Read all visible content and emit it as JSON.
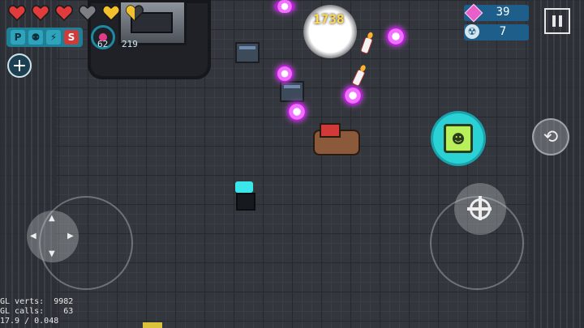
{
  "hud": {
    "hearts": [
      {
        "type": "full",
        "color": "#e23b3b"
      },
      {
        "type": "full",
        "color": "#e23b3b"
      },
      {
        "type": "full",
        "color": "#e23b3b"
      },
      {
        "type": "empty",
        "color": "#7d7f84"
      },
      {
        "type": "armor",
        "color": "#f2c12b"
      },
      {
        "type": "armor-half",
        "color": "#f2c12b"
      }
    ],
    "buffs": [
      {
        "label": "P",
        "icon": "p-buff-icon"
      },
      {
        "label": "⚉",
        "icon": "skull-buff-icon"
      },
      {
        "label": "⚡",
        "icon": "lightning-buff-icon"
      },
      {
        "label": "S",
        "icon": "speed-buff-icon"
      }
    ],
    "ammo_primary": "62",
    "ammo_secondary": "219",
    "gems": "39",
    "cores": "7",
    "damage_number": "1738"
  },
  "controls": {
    "add_label": "+",
    "skill_icon": "demon-face-icon",
    "swap_icon": "weapon-swap-icon",
    "fire_icon": "crosshair-icon",
    "joystick_icon": "dpad-icon"
  },
  "debug": {
    "gl_verts_label": "GL verts:",
    "gl_verts": "9982",
    "gl_calls_label": "GL calls:",
    "gl_calls": "63",
    "fps_line": "17.9 / 0.048"
  }
}
